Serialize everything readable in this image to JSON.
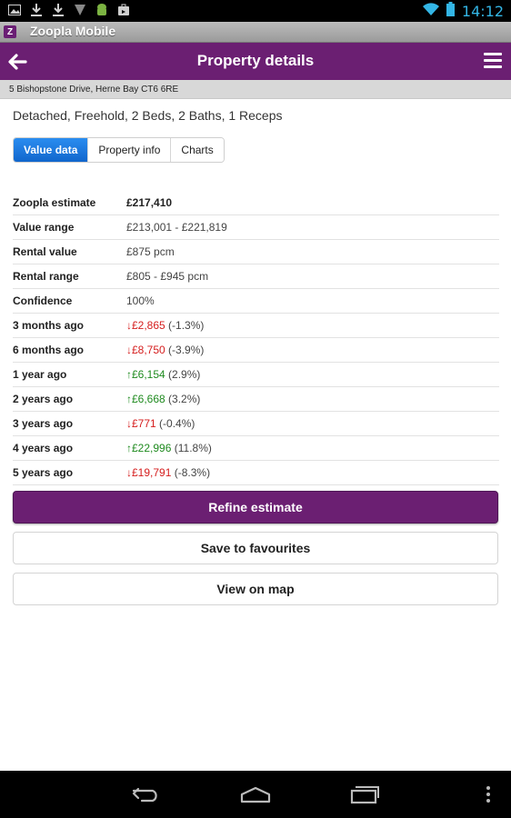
{
  "status_bar": {
    "time": "14:12",
    "icons_left": [
      "image-icon",
      "download-icon",
      "download-icon",
      "signal-off-icon",
      "android-icon",
      "store-icon"
    ],
    "icons_right": [
      "wifi-icon",
      "battery-icon"
    ]
  },
  "app": {
    "title": "Zoopla Mobile",
    "icon_letter": "Z"
  },
  "header": {
    "title": "Property details"
  },
  "address": "5 Bishopstone Drive, Herne Bay CT6 6RE",
  "summary": "Detached, Freehold, 2 Beds, 2 Baths, 1 Receps",
  "tabs": [
    {
      "label": "Value data",
      "active": true
    },
    {
      "label": "Property info",
      "active": false
    },
    {
      "label": "Charts",
      "active": false
    }
  ],
  "rows": {
    "estimate": {
      "label": "Zoopla estimate",
      "value": "£217,410"
    },
    "value_range": {
      "label": "Value range",
      "value": "£213,001 - £221,819"
    },
    "rental_value": {
      "label": "Rental value",
      "value": "£875 pcm"
    },
    "rental_range": {
      "label": "Rental range",
      "value": "£805 - £945 pcm"
    },
    "confidence": {
      "label": "Confidence",
      "value": "100%"
    },
    "m3": {
      "label": "3 months ago",
      "arrow": "↓",
      "change": "£2,865",
      "pct": "(-1.3%)"
    },
    "m6": {
      "label": "6 months ago",
      "arrow": "↓",
      "change": "£8,750",
      "pct": "(-3.9%)"
    },
    "y1": {
      "label": "1 year ago",
      "arrow": "↑",
      "change": "£6,154",
      "pct": "(2.9%)"
    },
    "y2": {
      "label": "2 years ago",
      "arrow": "↑",
      "change": "£6,668",
      "pct": "(3.2%)"
    },
    "y3": {
      "label": "3 years ago",
      "arrow": "↓",
      "change": "£771",
      "pct": "(-0.4%)"
    },
    "y4": {
      "label": "4 years ago",
      "arrow": "↑",
      "change": "£22,996",
      "pct": "(11.8%)"
    },
    "y5": {
      "label": "5 years ago",
      "arrow": "↓",
      "change": "£19,791",
      "pct": "(-8.3%)"
    }
  },
  "buttons": {
    "refine": "Refine estimate",
    "favourites": "Save to favourites",
    "map": "View on map"
  },
  "colors": {
    "brand_purple": "#6b1f72",
    "tab_active_blue": "#1a78e0",
    "down_red": "#d51d1d",
    "up_green": "#1e8a1e",
    "clock_blue": "#33b5e5"
  }
}
